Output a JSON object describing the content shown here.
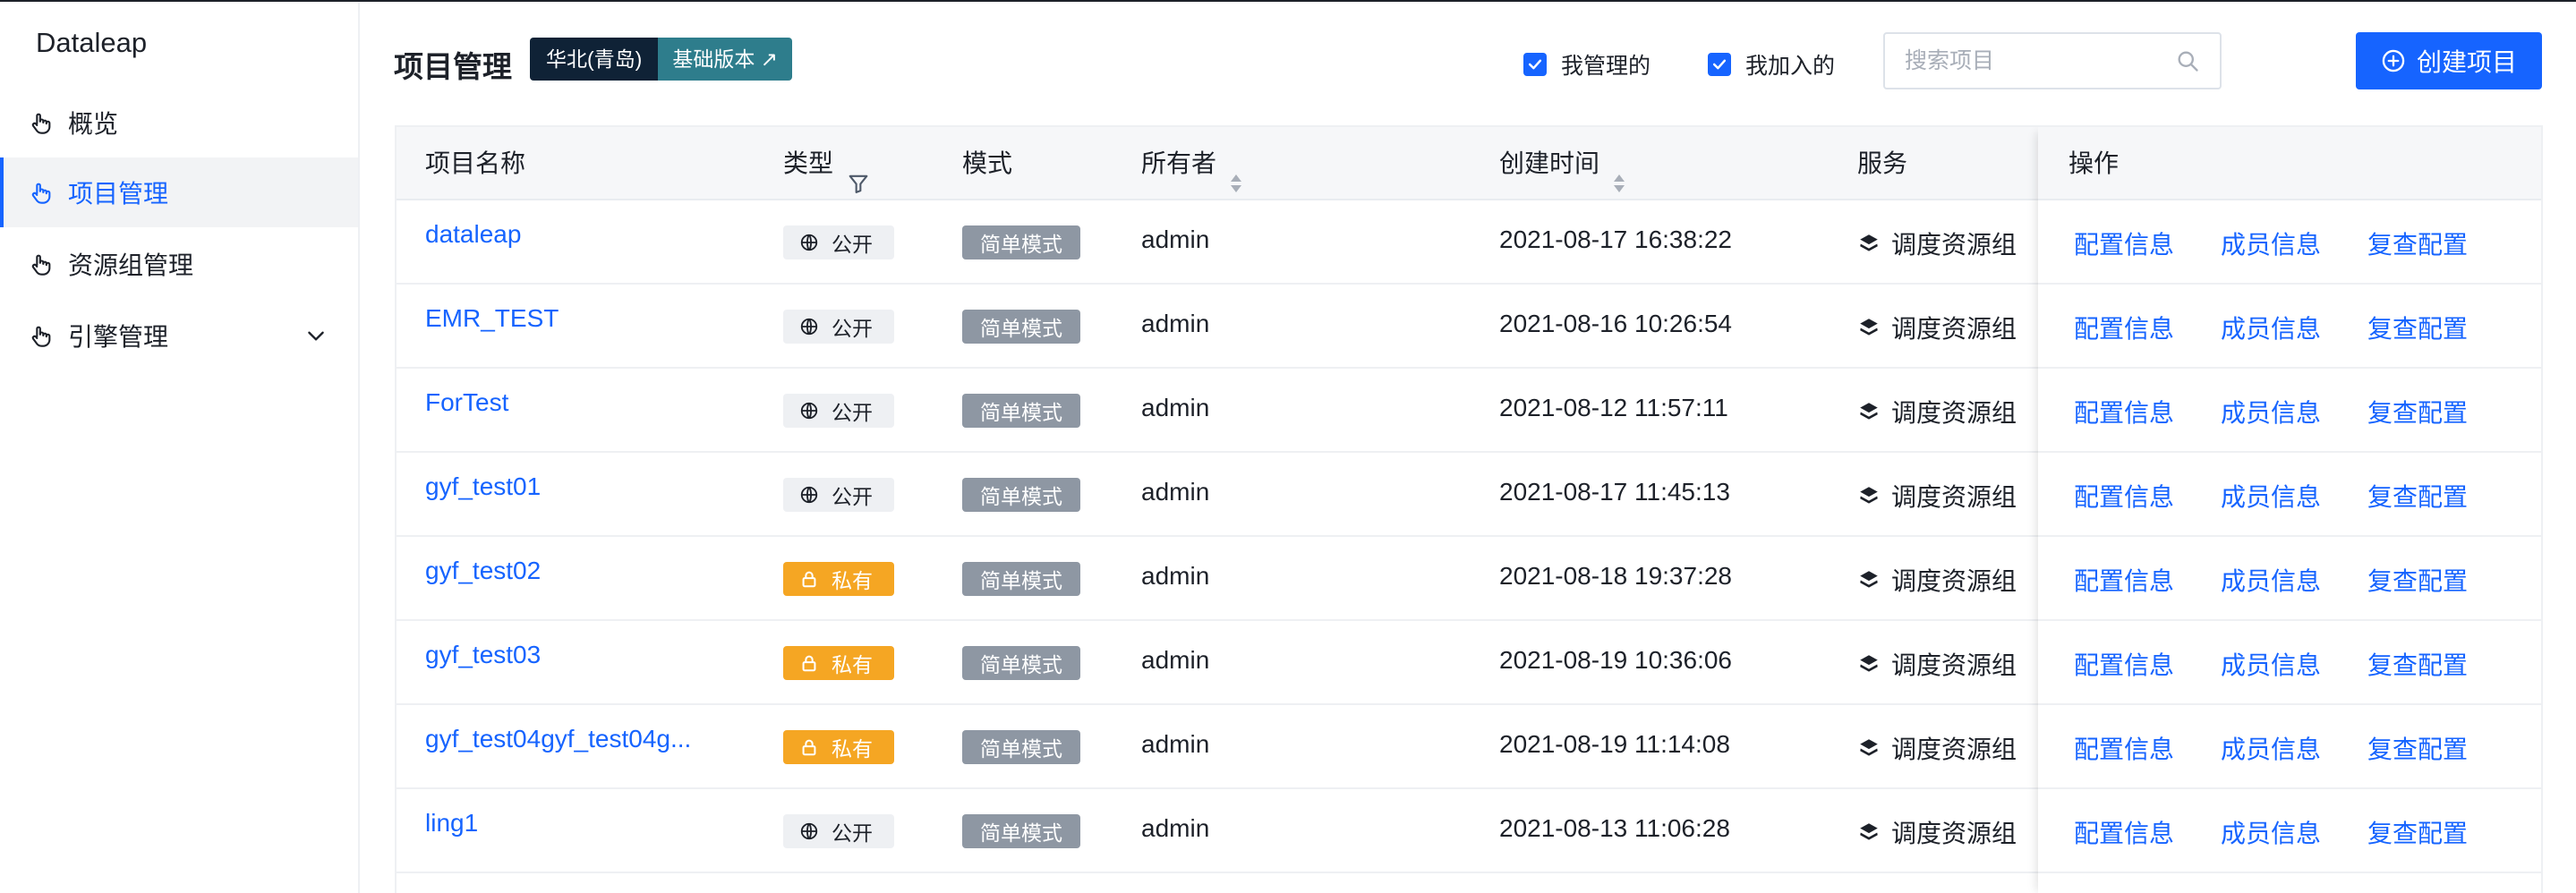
{
  "app": {
    "brand": "Dataleap"
  },
  "sidebar": {
    "items": [
      {
        "label": "概览",
        "icon": "hand-pointer-icon",
        "active": false
      },
      {
        "label": "项目管理",
        "icon": "hand-pointer-icon",
        "active": true
      },
      {
        "label": "资源组管理",
        "icon": "hand-pointer-icon",
        "active": false
      },
      {
        "label": "引擎管理",
        "icon": "hand-pointer-icon",
        "active": false,
        "expandable": true
      }
    ]
  },
  "header": {
    "title": "项目管理",
    "region": "华北(青岛)",
    "version": "基础版本",
    "version_icon": "external-arrow-icon",
    "filters": [
      {
        "label": "我管理的",
        "checked": true
      },
      {
        "label": "我加入的",
        "checked": true
      }
    ],
    "search": {
      "placeholder": "搜索项目",
      "value": ""
    },
    "create_label": "创建项目"
  },
  "table": {
    "columns": {
      "name": "项目名称",
      "type": "类型",
      "mode": "模式",
      "owner": "所有者",
      "created": "创建时间",
      "service": "服务",
      "actions": "操作"
    },
    "rows": [
      {
        "name": "dataleap",
        "type": "公开",
        "visibility": "public",
        "mode": "简单模式",
        "owner": "admin",
        "created": "2021-08-17 16:38:22",
        "service": "调度资源组",
        "actions": [
          "配置信息",
          "成员信息",
          "复查配置"
        ]
      },
      {
        "name": "EMR_TEST",
        "type": "公开",
        "visibility": "public",
        "mode": "简单模式",
        "owner": "admin",
        "created": "2021-08-16 10:26:54",
        "service": "调度资源组",
        "actions": [
          "配置信息",
          "成员信息",
          "复查配置"
        ]
      },
      {
        "name": "ForTest",
        "type": "公开",
        "visibility": "public",
        "mode": "简单模式",
        "owner": "admin",
        "created": "2021-08-12 11:57:11",
        "service": "调度资源组",
        "actions": [
          "配置信息",
          "成员信息",
          "复查配置"
        ]
      },
      {
        "name": "gyf_test01",
        "type": "公开",
        "visibility": "public",
        "mode": "简单模式",
        "owner": "admin",
        "created": "2021-08-17 11:45:13",
        "service": "调度资源组",
        "actions": [
          "配置信息",
          "成员信息",
          "复查配置"
        ]
      },
      {
        "name": "gyf_test02",
        "type": "私有",
        "visibility": "private",
        "mode": "简单模式",
        "owner": "admin",
        "created": "2021-08-18 19:37:28",
        "service": "调度资源组",
        "actions": [
          "配置信息",
          "成员信息",
          "复查配置"
        ]
      },
      {
        "name": "gyf_test03",
        "type": "私有",
        "visibility": "private",
        "mode": "简单模式",
        "owner": "admin",
        "created": "2021-08-19 10:36:06",
        "service": "调度资源组",
        "actions": [
          "配置信息",
          "成员信息",
          "复查配置"
        ]
      },
      {
        "name": "gyf_test04gyf_test04g...",
        "type": "私有",
        "visibility": "private",
        "mode": "简单模式",
        "owner": "admin",
        "created": "2021-08-19 11:14:08",
        "service": "调度资源组",
        "actions": [
          "配置信息",
          "成员信息",
          "复查配置"
        ]
      },
      {
        "name": "ling1",
        "type": "公开",
        "visibility": "public",
        "mode": "简单模式",
        "owner": "admin",
        "created": "2021-08-13 11:06:28",
        "service": "调度资源组",
        "actions": [
          "配置信息",
          "成员信息",
          "复查配置"
        ]
      }
    ]
  },
  "colors": {
    "accent": "#1664ff",
    "private_tag": "#f5a623",
    "mode_tag": "#8e97a3",
    "region_dark": "#0f2236",
    "version_teal": "#2e7d8c"
  }
}
